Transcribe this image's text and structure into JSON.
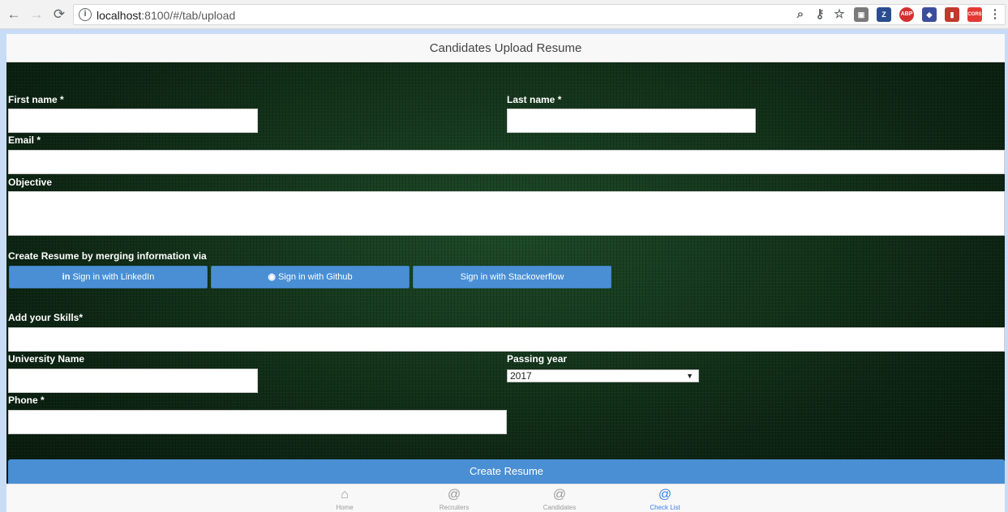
{
  "browser": {
    "url_host": "localhost",
    "url_rest": ":8100/#/tab/upload"
  },
  "app": {
    "title": "Candidates Upload Resume"
  },
  "form": {
    "first_name_label": "First name *",
    "last_name_label": "Last name *",
    "email_label": "Email *",
    "objective_label": "Objective",
    "merge_label": "Create Resume by merging information via",
    "linkedin_label": "Sign in with LinkedIn",
    "github_label": "Sign in with Github",
    "stackoverflow_label": "Sign in with Stackoverflow",
    "skills_label": "Add your Skills*",
    "university_label": "University Name",
    "passing_year_label": "Passing year",
    "passing_year_value": "2017",
    "phone_label": "Phone *",
    "create_button": "Create Resume"
  },
  "tabs": [
    {
      "label": "Home",
      "icon": "home-icon"
    },
    {
      "label": "Recruiters",
      "icon": "at-icon"
    },
    {
      "label": "Candidates",
      "icon": "at-icon"
    },
    {
      "label": "Check List",
      "icon": "at-icon"
    }
  ],
  "colors": {
    "primary_button": "#4a8fd4",
    "active_tab": "#387ef5",
    "background": "#0f2a17"
  }
}
